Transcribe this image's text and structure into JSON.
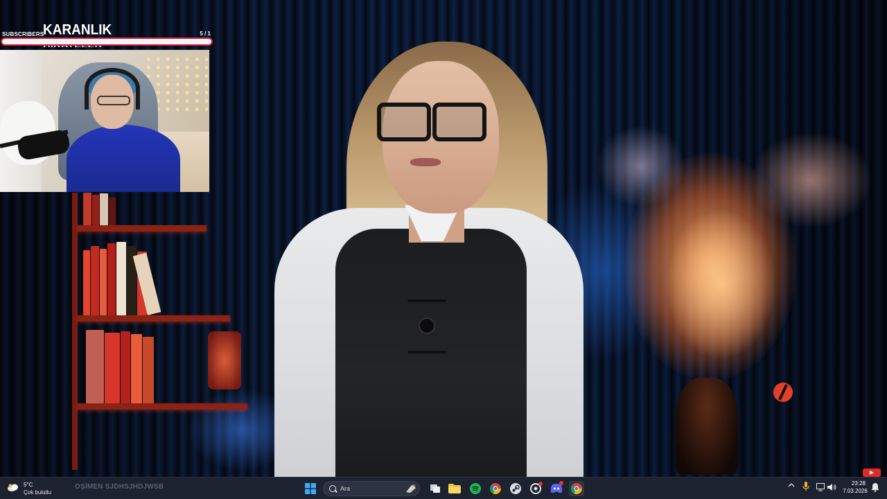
{
  "overlay": {
    "subscriber_goal": {
      "label": "SUBSCRIBERS",
      "title": "KARANLIK",
      "title_line2": "HİKAYELER",
      "count": "5 / 1",
      "progress_fraction": 1.0,
      "accent_color": "#d8193f"
    }
  },
  "taskbar": {
    "weather": {
      "temperature": "5°C",
      "condition": "Çok bulutlu"
    },
    "ticker_text": "OŞİMEN SJDHSJHDJWSB",
    "search_placeholder": "Ara",
    "apps": [
      {
        "name": "start",
        "icon": "windows-icon"
      },
      {
        "name": "search",
        "icon": "search-icon"
      },
      {
        "name": "task-view",
        "icon": "task-view-icon"
      },
      {
        "name": "file-explorer",
        "icon": "folder-icon"
      },
      {
        "name": "spotify",
        "icon": "spotify-icon"
      },
      {
        "name": "chrome",
        "icon": "chrome-icon"
      },
      {
        "name": "steam",
        "icon": "steam-icon"
      },
      {
        "name": "ubisoft",
        "icon": "ubisoft-icon"
      },
      {
        "name": "discord",
        "icon": "discord-icon"
      },
      {
        "name": "chrome-2",
        "icon": "chrome-icon"
      }
    ],
    "clock": {
      "time": "23:28",
      "date": "7.03.2026"
    }
  },
  "colors": {
    "taskbar_bg": "#1d2230",
    "spotify": "#1db954",
    "folder": "#f4c542",
    "discord": "#5865f2"
  }
}
